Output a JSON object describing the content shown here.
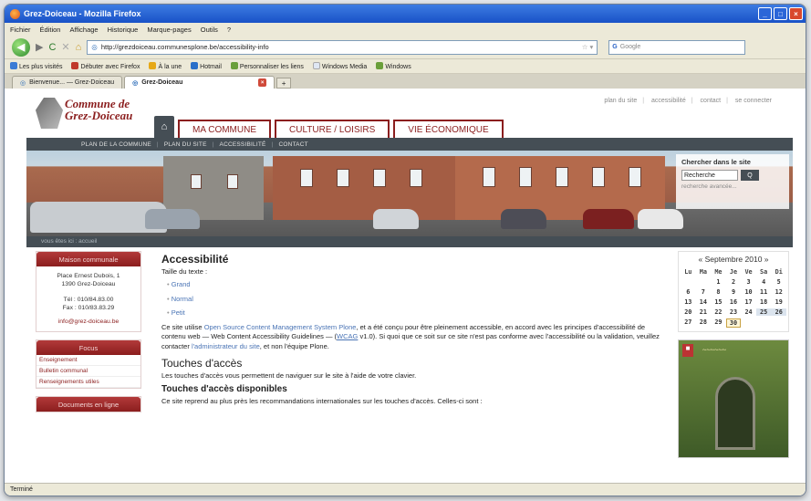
{
  "window": {
    "title": "Grez-Doiceau - Mozilla Firefox"
  },
  "menu": [
    "Fichier",
    "Édition",
    "Affichage",
    "Historique",
    "Marque-pages",
    "Outils",
    "?"
  ],
  "nav": {
    "url": "http://grezdoiceau.communesplone.be/accessibility-info",
    "search_placeholder": "Google"
  },
  "bookmarks": [
    "Les plus visités",
    "Débuter avec Firefox",
    "À la une",
    "Hotmail",
    "Personnaliser les liens",
    "Windows Media",
    "Windows"
  ],
  "tabs": [
    {
      "label": "Bienvenue... — Grez-Doiceau"
    },
    {
      "label": "Grez-Doiceau"
    }
  ],
  "site": {
    "logo_line1": "Commune de",
    "logo_line2": "Grez-Doiceau",
    "toplinks": [
      "plan du site",
      "accessibilité",
      "contact",
      "se connecter"
    ],
    "main_tabs": [
      "MA COMMUNE",
      "CULTURE / LOISIRS",
      "VIE ÉCONOMIQUE"
    ],
    "subnav": [
      "PLAN DE LA COMMUNE",
      "PLAN DU SITE",
      "ACCESSIBILITÉ",
      "CONTACT"
    ],
    "search": {
      "title": "Chercher dans le site",
      "input": "Recherche",
      "button": "Q",
      "advanced": "recherche avancée..."
    },
    "breadcrumb": "vous êtes ici : accueil"
  },
  "left": {
    "portlet1": {
      "title": "Maison communale",
      "address1": "Place Ernest Dubois, 1",
      "address2": "1390 Grez-Doiceau",
      "tel": "Tél : 010/84.83.00",
      "fax": "Fax : 010/83.83.29",
      "email": "info@grez-doiceau.be"
    },
    "portlet2": {
      "title": "Focus",
      "links": [
        "Enseignement",
        "Bulletin communal",
        "Renseignements utiles"
      ]
    },
    "portlet3": {
      "title": "Documents en ligne"
    }
  },
  "main": {
    "title": "Accessibilité",
    "size_label": "Taille du texte :",
    "sizes": [
      "Grand",
      "Normal",
      "Petit"
    ],
    "p1_a": "Ce site utilise ",
    "p1_link": "Open Source Content Management System Plone",
    "p1_b": ", et a été conçu pour être pleinement accessible, en accord avec les principes d'accessibilité de contenu web — Web Content Accessibility Guidelines — (",
    "p1_wcag": "WCAG",
    "p1_c": " v1.0). Si quoi que ce soit sur ce site n'est pas conforme avec l'accessibilité ou la validation, veuillez contacter ",
    "p1_admin": "l'administrateur du site",
    "p1_d": ", et non l'équipe Plone.",
    "h2": "Touches d'accès",
    "p2": "Les touches d'accès vous permettent de naviguer sur le site à l'aide de votre clavier.",
    "h3": "Touches d'accès disponibles",
    "p3": "Ce site reprend au plus près les recommandations internationales sur les touches d'accès. Celles-ci sont :"
  },
  "calendar": {
    "title": "« Septembre 2010 »",
    "days": [
      "Lu",
      "Ma",
      "Me",
      "Je",
      "Ve",
      "Sa",
      "Di"
    ],
    "cells": [
      "",
      "",
      "1",
      "2",
      "3",
      "4",
      "5",
      "6",
      "7",
      "8",
      "9",
      "10",
      "11",
      "12",
      "13",
      "14",
      "15",
      "16",
      "17",
      "18",
      "19",
      "20",
      "21",
      "22",
      "23",
      "24",
      "25",
      "26",
      "27",
      "28",
      "29",
      "30",
      "",
      "",
      ""
    ]
  },
  "status": "Terminé"
}
